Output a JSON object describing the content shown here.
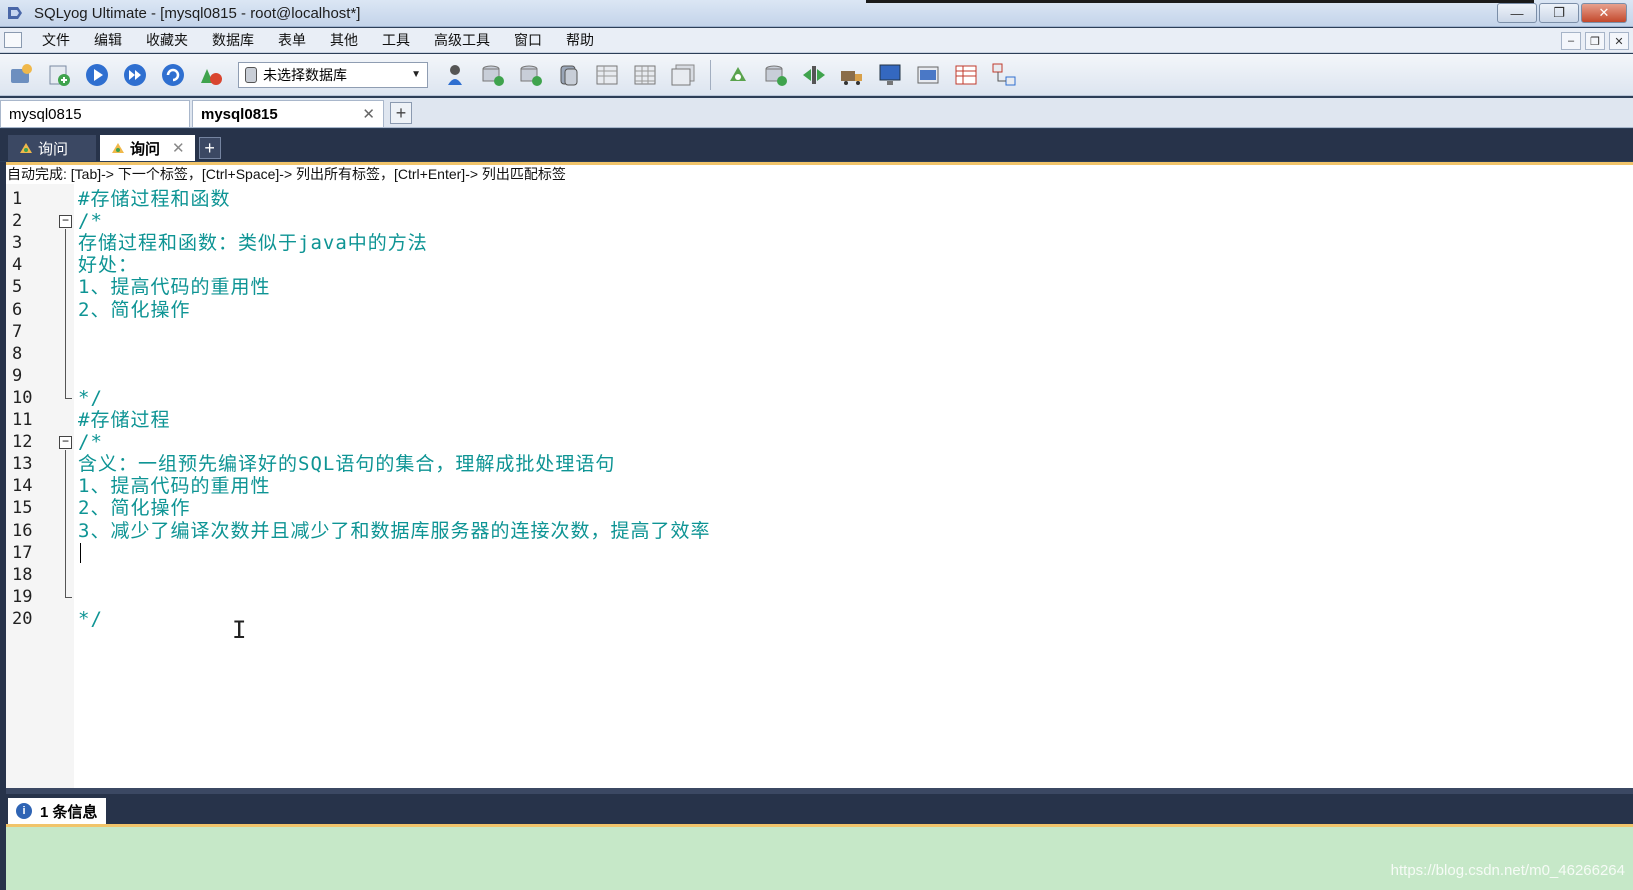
{
  "window": {
    "title": "SQLyog Ultimate - [mysql0815 - root@localhost*]",
    "controls": {
      "minimize": "—",
      "restore": "❐",
      "close": "✕"
    }
  },
  "menu": {
    "items": [
      "文件",
      "编辑",
      "收藏夹",
      "数据库",
      "表单",
      "其他",
      "工具",
      "高级工具",
      "窗口",
      "帮助"
    ],
    "mdi": {
      "minimize": "–",
      "restore": "❐",
      "close": "✕"
    }
  },
  "toolbar": {
    "db_select": "未选择数据库"
  },
  "connections": {
    "tabs": [
      "mysql0815",
      "mysql0815"
    ],
    "close": "✕",
    "add": "+"
  },
  "query_tabs": {
    "tabs": [
      "询问",
      "询问"
    ],
    "close": "✕",
    "add": "+"
  },
  "autocomplete_hint": "自动完成: [Tab]-> 下一个标签，[Ctrl+Space]-> 列出所有标签，[Ctrl+Enter]-> 列出匹配标签",
  "editor": {
    "lines": [
      {
        "n": "1",
        "text": "#存储过程和函数"
      },
      {
        "n": "2",
        "text": "/*"
      },
      {
        "n": "3",
        "text": "存储过程和函数：类似于java中的方法"
      },
      {
        "n": "4",
        "text": "好处："
      },
      {
        "n": "5",
        "text": "1、提高代码的重用性"
      },
      {
        "n": "6",
        "text": "2、简化操作"
      },
      {
        "n": "7",
        "text": ""
      },
      {
        "n": "8",
        "text": ""
      },
      {
        "n": "9",
        "text": ""
      },
      {
        "n": "10",
        "text": "*/"
      },
      {
        "n": "11",
        "text": "#存储过程"
      },
      {
        "n": "12",
        "text": "/*"
      },
      {
        "n": "13",
        "text": "含义：一组预先编译好的SQL语句的集合，理解成批处理语句"
      },
      {
        "n": "14",
        "text": "1、提高代码的重用性"
      },
      {
        "n": "15",
        "text": "2、简化操作"
      },
      {
        "n": "16",
        "text": "3、减少了编译次数并且减少了和数据库服务器的连接次数，提高了效率"
      },
      {
        "n": "17",
        "text": ""
      },
      {
        "n": "18",
        "text": ""
      },
      {
        "n": "19",
        "text": ""
      },
      {
        "n": "20",
        "text": "*/"
      }
    ],
    "fold_symbol": "−"
  },
  "results": {
    "tab_label": "1 条信息",
    "info_icon": "i"
  },
  "watermark": "https://blog.csdn.net/m0_46266264",
  "colors": {
    "code": "#0e9494",
    "result_bg": "#c6e8c8",
    "accent_border": "#f1c46a",
    "dark_frame": "#27334a"
  }
}
